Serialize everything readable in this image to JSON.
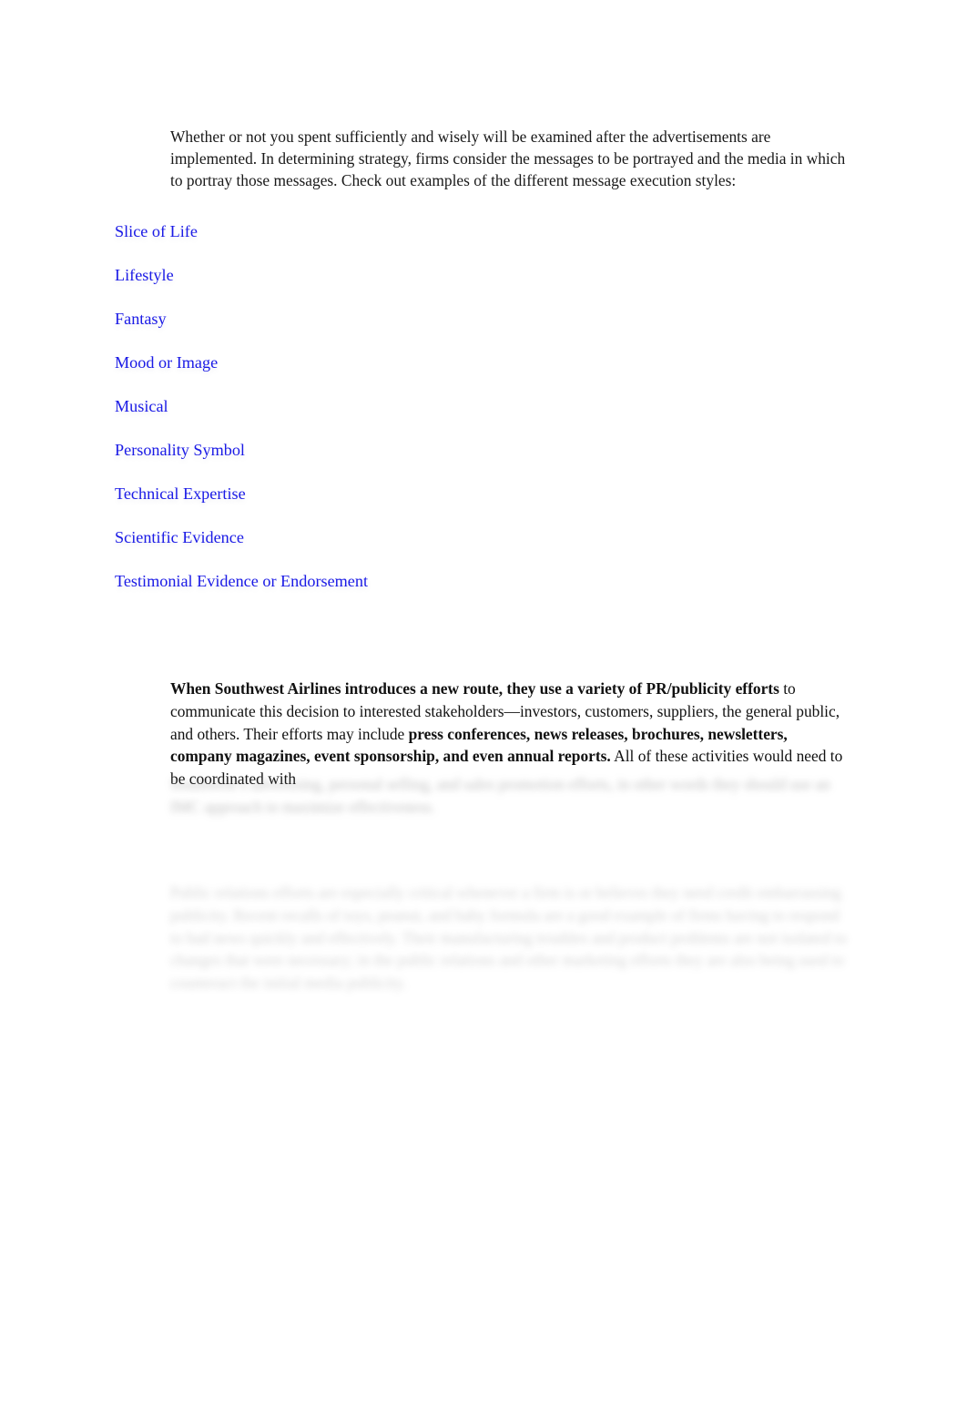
{
  "document": {
    "background_color": "#ffffff",
    "text_color": "#181818",
    "link_color": "#1a1ae6"
  },
  "intro": {
    "paragraph": "Whether or not you spent sufficiently and wisely will be examined after the advertisements are implemented. In determining strategy, firms consider the messages to be portrayed and the media in which to portray those messages. Check out examples of the different message execution styles:"
  },
  "execution_styles": {
    "links": [
      {
        "label": "Slice of Life"
      },
      {
        "label": "Lifestyle"
      },
      {
        "label": "Fantasy"
      },
      {
        "label": "Mood or Image"
      },
      {
        "label": "Musical"
      },
      {
        "label": "Personality Symbol"
      },
      {
        "label": "Technical Expertise"
      },
      {
        "label": "Scientific Evidence"
      },
      {
        "label": "Testimonial Evidence or Endorsement"
      }
    ]
  },
  "southwest_paragraph": {
    "bold_lead": "When Southwest Airlines introduces a new route, they use a variety of PR/publicity efforts",
    "normal_mid": " to communicate this decision to interested stakeholders—investors, customers, suppliers, the general public, and others. Their efforts may include  ",
    "bold_list": "press conferences, news releases, brochures, newsletters, company magazines, event sponsorship, and even annual reports.",
    "normal_tail": "  All of these activities would need to be coordinated with"
  },
  "obscured": {
    "note": "illegible blurred text",
    "block_1_lines": [
      "Southwest’s advertising, personal selling, and sales promotion efforts, in other words",
      "they should use an IMC approach to maximize effectiveness."
    ],
    "block_2_lines": [
      "Public relations efforts are especially critical whenever a firm is or believes they",
      "need credit embarrassing publicity.       Recent recalls of toys, peanut, and baby",
      "formula are a good example of firms having to respond to bad news quickly and",
      "effectively. Their manufacturing troubles and product problems are not isolated",
      "to changes that were necessary; in the public relations and other marketing efforts",
      "they are also being used to counteract the initial media publicity."
    ]
  }
}
